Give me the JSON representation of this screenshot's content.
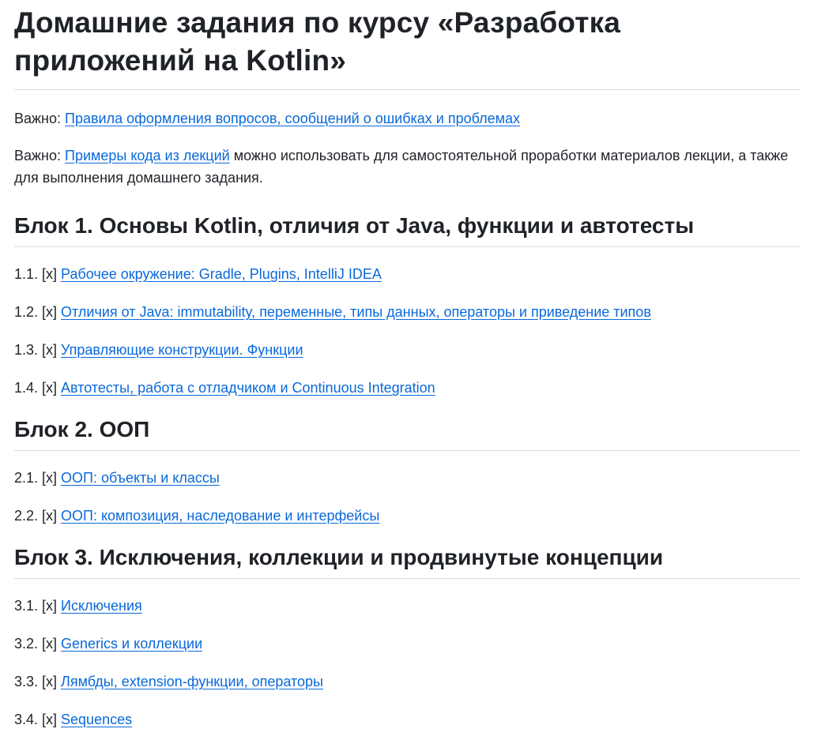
{
  "title": "Домашние задания по курсу «Разработка приложений на Kotlin»",
  "intro": [
    {
      "prefix": "Важно: ",
      "link": "Правила оформления вопросов, сообщений о ошибках и проблемах",
      "suffix": ""
    },
    {
      "prefix": "Важно: ",
      "link": "Примеры кода из лекций",
      "suffix": " можно использовать для самостоятельной проработки материалов лекции, а также для выполнения домашнего задания."
    }
  ],
  "blocks": [
    {
      "heading": "Блок 1. Основы Kotlin, отличия от Java, функции и автотесты",
      "items": [
        {
          "prefix": "1.1. [x] ",
          "link": "Рабочее окружение: Gradle, Plugins, IntelliJ IDEA"
        },
        {
          "prefix": "1.2. [x] ",
          "link": "Отличия от Java: immutability, переменные, типы данных, операторы и приведение типов"
        },
        {
          "prefix": "1.3. [x] ",
          "link": "Управляющие конструкции. Функции"
        },
        {
          "prefix": "1.4. [x] ",
          "link": "Автотесты, работа с отладчиком и Continuous Integration"
        }
      ]
    },
    {
      "heading": "Блок 2. ООП",
      "items": [
        {
          "prefix": "2.1. [x] ",
          "link": "ООП: объекты и классы"
        },
        {
          "prefix": "2.2. [x] ",
          "link": "ООП: композиция, наследование и интерфейсы"
        }
      ]
    },
    {
      "heading": "Блок 3. Исключения, коллекции и продвинутые концепции",
      "items": [
        {
          "prefix": "3.1. [x] ",
          "link": "Исключения"
        },
        {
          "prefix": "3.2. [x] ",
          "link": "Generics и коллекции"
        },
        {
          "prefix": "3.3. [x] ",
          "link": "Лямбды, extension-функции, операторы"
        },
        {
          "prefix": "3.4. [x] ",
          "link": "Sequences"
        }
      ]
    }
  ],
  "colors": {
    "link": "#0969da",
    "text": "#1f2328",
    "divider": "#d8dee4"
  }
}
